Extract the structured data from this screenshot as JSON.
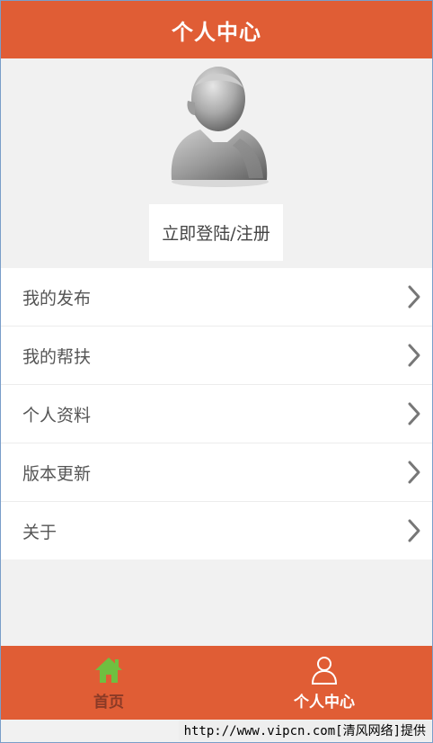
{
  "header": {
    "title": "个人中心"
  },
  "profile": {
    "login_label": "立即登陆/注册",
    "avatar_icon": "user-silhouette-icon"
  },
  "menu": {
    "items": [
      {
        "label": "我的发布"
      },
      {
        "label": "我的帮扶"
      },
      {
        "label": "个人资料"
      },
      {
        "label": "版本更新"
      },
      {
        "label": "关于"
      }
    ]
  },
  "tabbar": {
    "tabs": [
      {
        "label": "首页",
        "icon": "home-icon",
        "icon_color": "#6fbf40"
      },
      {
        "label": "个人中心",
        "icon": "person-icon",
        "selected": true
      }
    ]
  },
  "footer": {
    "watermark": "http://www.vipcn.com[清风网络]提供"
  },
  "colors": {
    "accent": "#e05d35",
    "background": "#f1f1f1",
    "home_icon": "#6fbf40"
  }
}
